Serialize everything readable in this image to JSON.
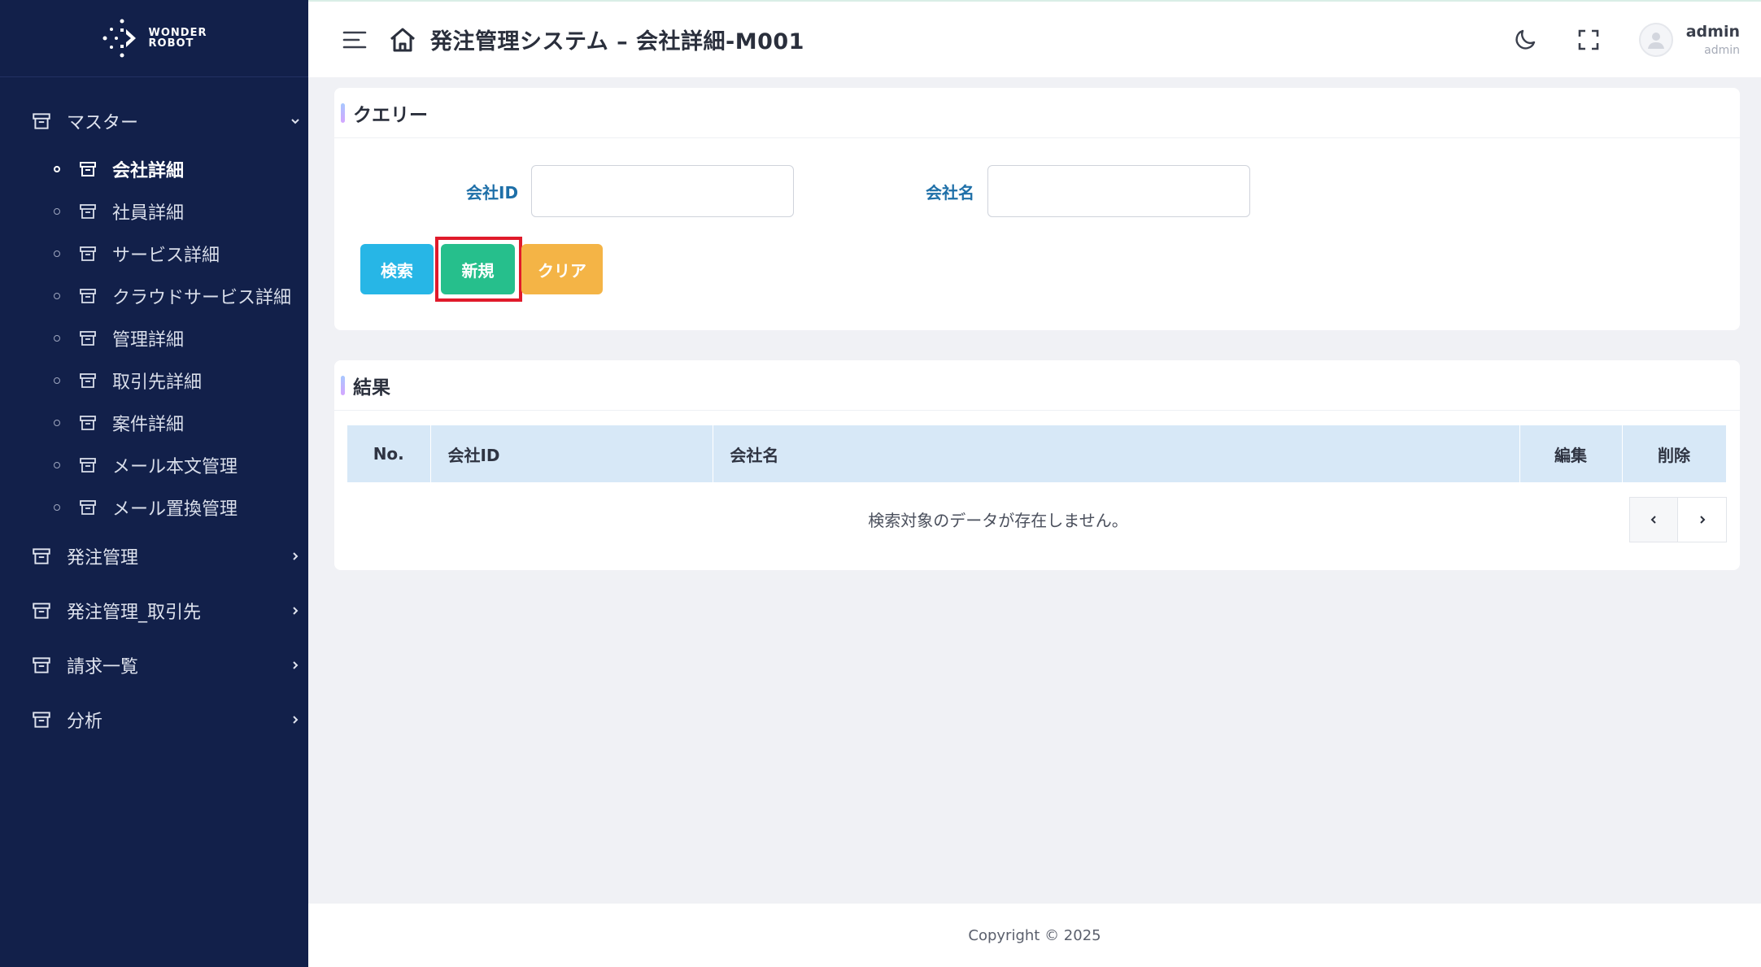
{
  "app": {
    "logo_line1": "WONDER",
    "logo_line2": "ROBOT",
    "title": "発注管理システム – 会社詳細-M001"
  },
  "sidebar": {
    "groups": [
      {
        "label": "マスター",
        "expanded": true
      },
      {
        "label": "発注管理"
      },
      {
        "label": "発注管理_取引先"
      },
      {
        "label": "請求一覧"
      },
      {
        "label": "分析"
      }
    ],
    "master_items": [
      {
        "label": "会社詳細",
        "active": true
      },
      {
        "label": "社員詳細"
      },
      {
        "label": "サービス詳細"
      },
      {
        "label": "クラウドサービス詳細"
      },
      {
        "label": "管理詳細"
      },
      {
        "label": "取引先詳細"
      },
      {
        "label": "案件詳細"
      },
      {
        "label": "メール本文管理"
      },
      {
        "label": "メール置換管理"
      }
    ]
  },
  "header": {
    "user_name": "admin",
    "user_role": "admin"
  },
  "query": {
    "title": "クエリー",
    "company_id_label": "会社ID",
    "company_id_value": "",
    "company_name_label": "会社名",
    "company_name_value": "",
    "search_label": "検索",
    "new_label": "新規",
    "clear_label": "クリア"
  },
  "result": {
    "title": "結果",
    "columns": [
      "No.",
      "会社ID",
      "会社名",
      "編集",
      "削除"
    ],
    "empty_message": "検索対象のデータが存在しません。"
  },
  "footer": {
    "copyright": "Copyright © 2025"
  },
  "colors": {
    "sidebar_bg": "#12204a",
    "search_btn": "#27b6e6",
    "new_btn": "#26bf8c",
    "clear_btn": "#f4b446",
    "highlight": "#e01a2a",
    "table_header": "#d7e8f7"
  }
}
